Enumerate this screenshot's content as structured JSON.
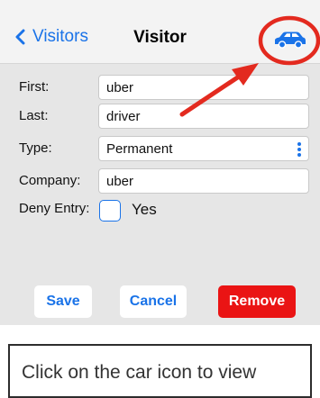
{
  "navbar": {
    "back_label": "Visitors",
    "title": "Visitor",
    "car_icon": "car-icon"
  },
  "form": {
    "first": {
      "label": "First:",
      "value": "uber"
    },
    "last": {
      "label": "Last:",
      "value": "driver"
    },
    "type": {
      "label": "Type:",
      "value": "Permanent"
    },
    "company": {
      "label": "Company:",
      "value": "uber"
    },
    "deny_entry": {
      "label": "Deny Entry:",
      "option": "Yes",
      "checked": false
    }
  },
  "buttons": {
    "save": "Save",
    "cancel": "Cancel",
    "remove": "Remove"
  },
  "caption": "Click on the car icon to view",
  "colors": {
    "accent": "#1a73e8",
    "remove": "#ea1414",
    "annotation": "#e32a1f",
    "form_bg": "#e6e6e6"
  }
}
